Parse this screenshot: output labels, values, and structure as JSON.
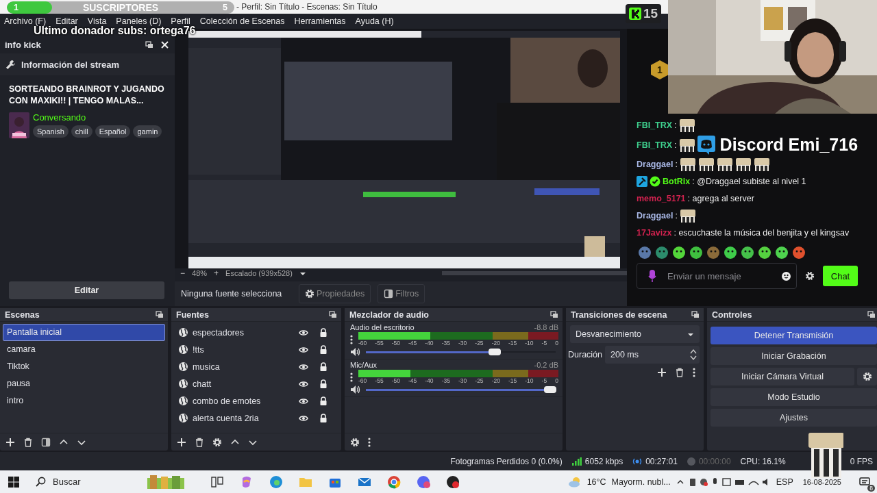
{
  "window": {
    "title": "- Perfil: Sin Título - Escenas: Sin Título"
  },
  "menu": [
    "Archivo (F)",
    "Editar",
    "Vista",
    "Paneles (D)",
    "Perfil",
    "Colección de Escenas",
    "Herramientas",
    "Ayuda (H)"
  ],
  "overlay": {
    "subs_goal": {
      "current": "1",
      "label": "SUSCRIPTORES",
      "target": "5",
      "level": 0.2
    },
    "last_donor": "Ultimo donador subs: ortega76",
    "kick_badge": "15",
    "level_badge": "1"
  },
  "info_dock": {
    "title": "info kick",
    "heading": "Información del stream",
    "stream_title": "SORTEANDO BRAINROT Y JUGANDO CON MAXIKI!! | TENGO MALAS...",
    "category": "Conversando",
    "tags": [
      "Spanish",
      "chill",
      "Español",
      "gamin"
    ],
    "edit_button": "Editar"
  },
  "preview": {
    "kind": "picture",
    "zoom_out": "−",
    "zoom": "48%",
    "zoom_in": "+",
    "scale": "Escalado (939x528)"
  },
  "source_toolbar": {
    "status": "Ninguna fuente selecciona",
    "buttons": [
      "Propiedades",
      "Filtros"
    ]
  },
  "chat": {
    "messages": [
      {
        "user": "FBI_TRX",
        "color": "#3ecf8e",
        "parts": [
          {
            "kind": "text",
            "text": ":"
          },
          {
            "kind": "emote"
          }
        ]
      },
      {
        "user": "FBI_TRX",
        "color": "#3ecf8e",
        "parts": [
          {
            "kind": "text",
            "text": ":"
          },
          {
            "kind": "emote"
          },
          {
            "kind": "discord",
            "text": "Discord Emi_716"
          }
        ]
      },
      {
        "user": "Draggael",
        "color": "#a9b8e6",
        "parts": [
          {
            "kind": "text",
            "text": ":"
          },
          {
            "kind": "emote"
          },
          {
            "kind": "emote"
          },
          {
            "kind": "emote"
          },
          {
            "kind": "emote"
          },
          {
            "kind": "emote"
          }
        ]
      },
      {
        "user": "BotRix",
        "color": "#53fc18",
        "moderator": true,
        "verified": true,
        "parts": [
          {
            "kind": "text",
            "text": ": @Draggael subiste al nivel 1"
          }
        ]
      },
      {
        "user": "memo_5171",
        "color": "#d2224f",
        "parts": [
          {
            "kind": "text",
            "text": ": agrega al server"
          }
        ]
      },
      {
        "user": "Draggael",
        "color": "#a9b8e6",
        "parts": [
          {
            "kind": "text",
            "text": ":"
          },
          {
            "kind": "emote"
          }
        ]
      },
      {
        "user": "17Javizx",
        "color": "#d2224f",
        "parts": [
          {
            "kind": "text",
            "text": ": escuchaste la música del benjita y el kingsav"
          }
        ]
      }
    ],
    "input_placeholder": "Enviar un mensaje",
    "send_button": "Chat"
  },
  "scenes": {
    "title": "Escenas",
    "items": [
      {
        "name": "Pantalla inicial",
        "selected": true
      },
      {
        "name": "camara",
        "selected": false
      },
      {
        "name": "Tiktok",
        "selected": false
      },
      {
        "name": "pausa",
        "selected": false
      },
      {
        "name": "intro",
        "selected": false
      }
    ]
  },
  "sources": {
    "title": "Fuentes",
    "items": [
      {
        "name": "espectadores",
        "visible": true,
        "locked": true
      },
      {
        "name": "!tts",
        "visible": true,
        "locked": true
      },
      {
        "name": "musica",
        "visible": true,
        "locked": true
      },
      {
        "name": "chatt",
        "visible": true,
        "locked": true
      },
      {
        "name": "combo de emotes",
        "visible": true,
        "locked": true
      },
      {
        "name": "alerta cuenta 2ria",
        "visible": true,
        "locked": true
      }
    ]
  },
  "mixer": {
    "title": "Mezclador de audio",
    "channels": [
      {
        "name": "Audio del escritorio",
        "reading": "-8.8 dB",
        "meter": {
          "level": 0.36
        },
        "fader": {
          "level": 0.68
        },
        "scale": [
          "-60",
          "-55",
          "-50",
          "-45",
          "-40",
          "-35",
          "-30",
          "-25",
          "-20",
          "-15",
          "-10",
          "-5",
          "0"
        ]
      },
      {
        "name": "Mic/Aux",
        "reading": "-0.2 dB",
        "meter": {
          "level": 0.26
        },
        "fader": {
          "level": 0.97
        },
        "scale": [
          "-60",
          "-55",
          "-50",
          "-45",
          "-40",
          "-35",
          "-30",
          "-25",
          "-20",
          "-15",
          "-10",
          "-5",
          "0"
        ]
      }
    ]
  },
  "transitions": {
    "title": "Transiciones de escena",
    "transition": "Desvanecimiento",
    "duration_label": "Duración",
    "duration": "200 ms"
  },
  "controls": {
    "title": "Controles",
    "buttons": [
      {
        "label": "Detener Transmisión",
        "active": true,
        "settings": false
      },
      {
        "label": "Iniciar Grabación",
        "active": false,
        "settings": false
      },
      {
        "label": "Iniciar Cámara Virtual",
        "active": false,
        "settings": true
      },
      {
        "label": "Modo Estudio",
        "active": false,
        "settings": false
      },
      {
        "label": "Ajustes",
        "active": false,
        "settings": false
      }
    ]
  },
  "status_bar": {
    "dropped_frames": "Fotogramas Perdidos 0 (0.0%)",
    "bitrate": "6052 kbps",
    "stream_time": "00:27:01",
    "record_time": "00:00:00",
    "cpu": "CPU: 16.1%",
    "fps": "0 FPS"
  },
  "taskbar": {
    "search_placeholder": "Buscar",
    "temperature": "16°C",
    "weather": "Mayorm. nubl...",
    "language": "ESP",
    "date": "16-08-2025",
    "notifications": "8"
  }
}
